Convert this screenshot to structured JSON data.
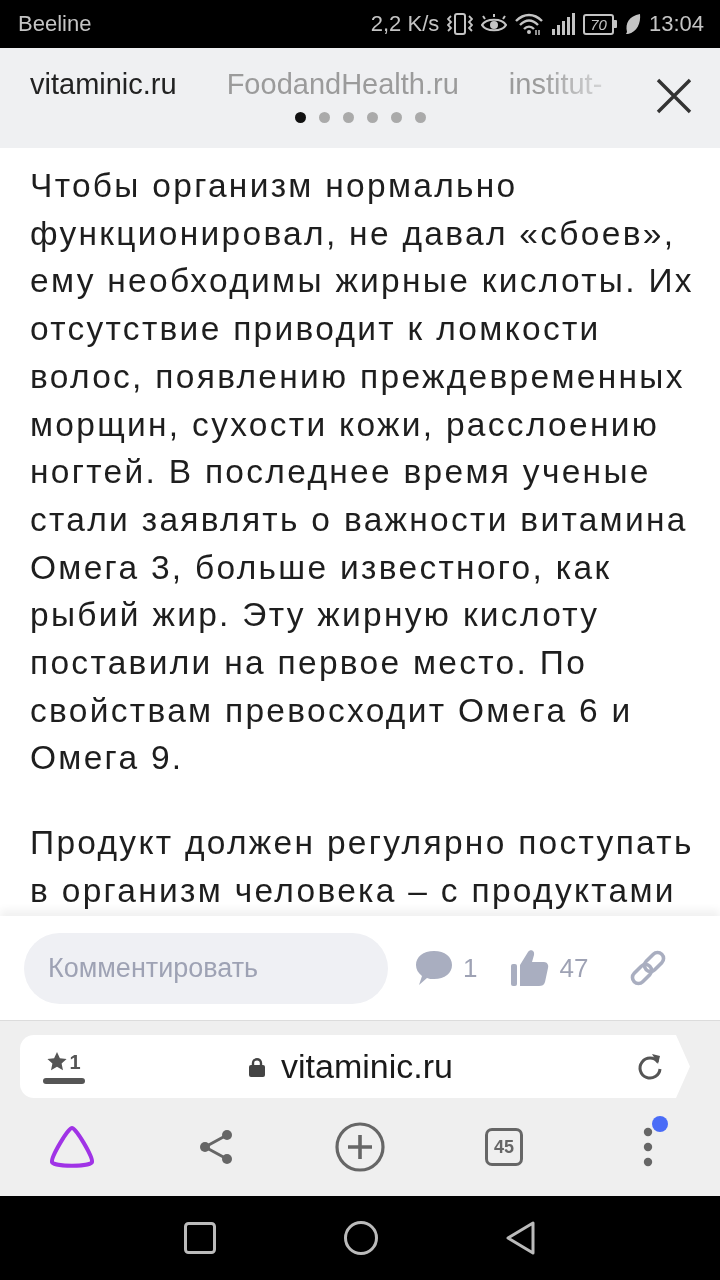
{
  "status_bar": {
    "carrier": "Beeline",
    "network_speed": "2,2 K/s",
    "battery": "70",
    "time": "13:04"
  },
  "source_tabs": {
    "tabs": [
      {
        "label": "vitaminic.ru",
        "selected": true
      },
      {
        "label": "FoodandHealth.ru",
        "selected": false
      },
      {
        "label": "institut-",
        "selected": false
      }
    ],
    "pages": [
      {
        "selected": true
      },
      {
        "selected": false
      },
      {
        "selected": false
      },
      {
        "selected": false
      },
      {
        "selected": false
      },
      {
        "selected": false
      }
    ]
  },
  "article": {
    "paragraphs": [
      "Чтобы организм нормально функционировал, не давал «сбоев», ему необходимы жирные кислоты. Их отсутствие приводит к ломкости волос, появлению преждевременных морщин, сухости кожи, расслоению ногтей. В последнее время ученые стали заявлять о важности витамина Омега 3, больше известного, как рыбий жир. Эту жирную кислоту поставили на первое место. По свойствам превосходит Омега 6 и Омега 9.",
      "Продукт должен регулярно поступать в организм человека – с продуктами"
    ]
  },
  "comment_bar": {
    "placeholder": "Комментировать",
    "comments": "1",
    "likes": "47"
  },
  "address_bar": {
    "bookmarks": "1",
    "url": "vitaminic.ru"
  },
  "toolbar": {
    "tabs_count": "45",
    "menu_notification": true
  }
}
